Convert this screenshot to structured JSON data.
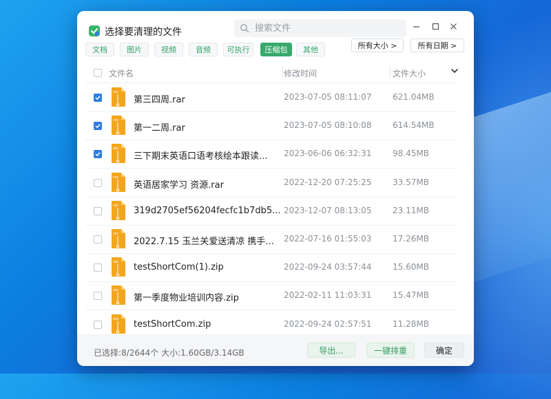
{
  "window": {
    "title": "选择要清理的文件",
    "search_placeholder": "搜索文件"
  },
  "filters": {
    "chips": [
      {
        "label": "文档",
        "active": false
      },
      {
        "label": "图片",
        "active": false
      },
      {
        "label": "视频",
        "active": false
      },
      {
        "label": "音频",
        "active": false
      },
      {
        "label": "可执行",
        "active": false
      },
      {
        "label": "压缩包",
        "active": true
      },
      {
        "label": "其他",
        "active": false
      }
    ],
    "size_dropdown": "所有大小 >",
    "date_dropdown": "所有日期 >"
  },
  "table": {
    "headers": {
      "name": "文件名",
      "modified": "修改时间",
      "size": "文件大小"
    },
    "rows": [
      {
        "name": "第三四周.rar",
        "modified": "2023-07-05 08:11:07",
        "size": "621.04MB",
        "checked": true,
        "ext": "rar"
      },
      {
        "name": "第一二周.rar",
        "modified": "2023-07-05 08:10:08",
        "size": "614.54MB",
        "checked": true,
        "ext": "rar"
      },
      {
        "name": "三下期末英语口语考核绘本跟读...",
        "modified": "2023-06-06 06:32:31",
        "size": "98.45MB",
        "checked": true,
        "ext": "zip"
      },
      {
        "name": "英语居家学习 资源.rar",
        "modified": "2022-12-20 07:25:25",
        "size": "33.57MB",
        "checked": false,
        "ext": "rar"
      },
      {
        "name": "319d2705ef56204fecfc1b7db5...",
        "modified": "2023-12-07 08:13:05",
        "size": "23.11MB",
        "checked": false,
        "ext": "rar"
      },
      {
        "name": "2022.7.15 玉兰关爱送清凉 携手...",
        "modified": "2022-07-16 01:55:03",
        "size": "17.26MB",
        "checked": false,
        "ext": "rar"
      },
      {
        "name": "testShortCom(1).zip",
        "modified": "2022-09-24 03:57:44",
        "size": "15.60MB",
        "checked": false,
        "ext": "zip"
      },
      {
        "name": "第一季度物业培训内容.zip",
        "modified": "2022-02-11 11:03:31",
        "size": "15.47MB",
        "checked": false,
        "ext": "zip"
      },
      {
        "name": "testShortCom.zip",
        "modified": "2022-09-24 02:57:51",
        "size": "11.28MB",
        "checked": false,
        "ext": "zip"
      }
    ]
  },
  "footer": {
    "status": "已选择:8/2644个 大小:1.60GB/3.14GB",
    "export_label": "导出...",
    "onekey_label": "一键排重",
    "ok_label": "确定"
  },
  "colors": {
    "accent_green": "#38a96d",
    "check_blue": "#2f7de1",
    "file_icon_orange": "#f4a51e"
  }
}
